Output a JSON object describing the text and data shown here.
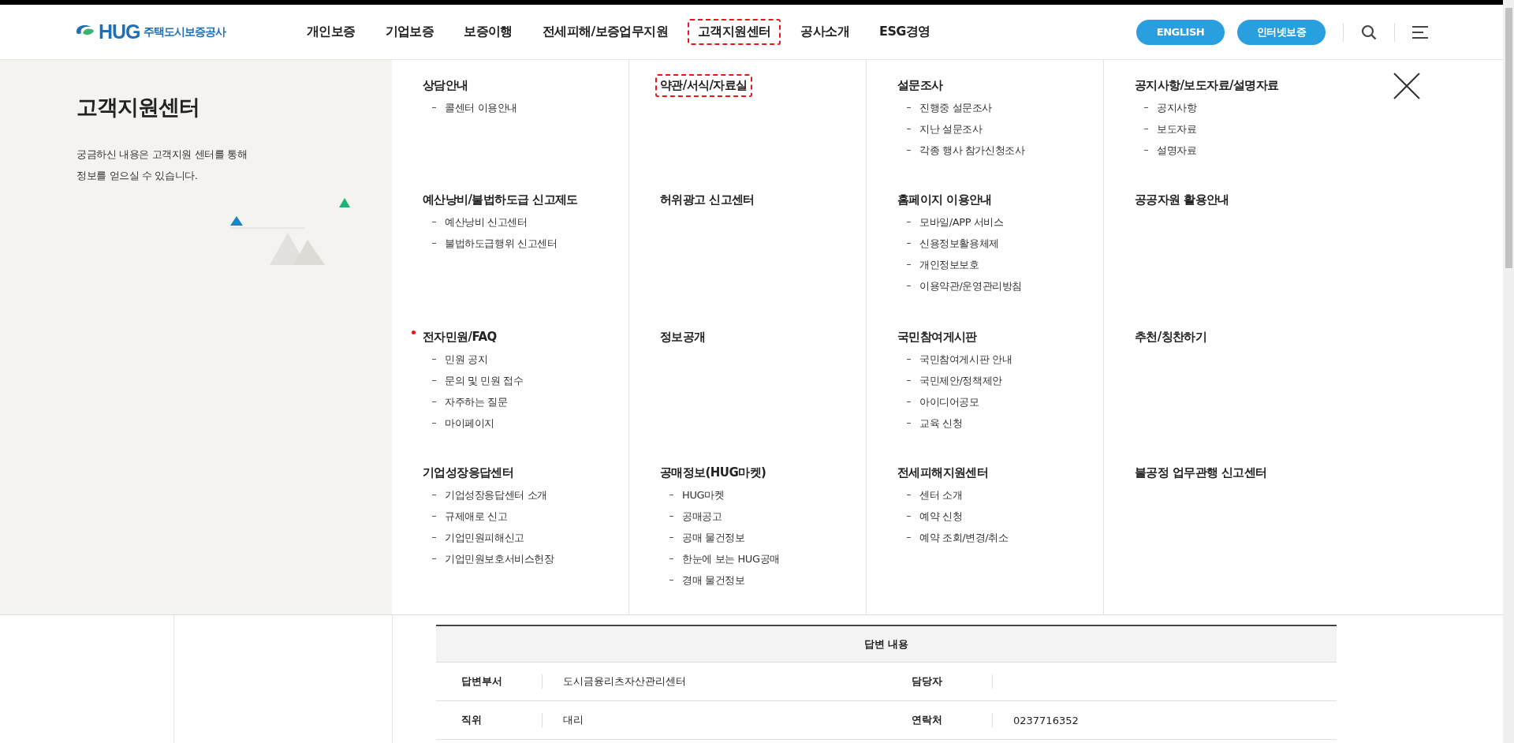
{
  "header": {
    "logo": {
      "brand": "HUG",
      "name": "주택도시보증공사"
    },
    "nav": [
      {
        "label": "개인보증",
        "highlighted": false
      },
      {
        "label": "기업보증",
        "highlighted": false
      },
      {
        "label": "보증이행",
        "highlighted": false
      },
      {
        "label": "전세피해/보증업무지원",
        "highlighted": false
      },
      {
        "label": "고객지원센터",
        "highlighted": true
      },
      {
        "label": "공사소개",
        "highlighted": false
      },
      {
        "label": "ESG경영",
        "highlighted": false
      }
    ],
    "buttons": [
      "ENGLISH",
      "인터넷보증"
    ]
  },
  "mega_menu": {
    "title": "고객지원센터",
    "description": "궁금하신 내용은 고객지원 센터를 통해\n정보를 얻으실 수 있습니다.",
    "sections": [
      {
        "title": "상담안내",
        "highlighted": false,
        "new": false,
        "items": [
          "콜센터 이용안내"
        ]
      },
      {
        "title": "약관/서식/자료실",
        "highlighted": true,
        "new": false
      },
      {
        "title": "설문조사",
        "highlighted": false,
        "new": false,
        "items": [
          "진행중 설문조사",
          "지난 설문조사",
          "각종 행사 참가신청조사"
        ]
      },
      {
        "title": "공지사항/보도자료/설명자료",
        "highlighted": false,
        "new": false,
        "items": [
          "공지사항",
          "보도자료",
          "설명자료"
        ]
      },
      {
        "title": "예산낭비/불법하도급 신고제도",
        "highlighted": false,
        "new": false,
        "items": [
          "예산낭비 신고센터",
          "불법하도급행위 신고센터"
        ]
      },
      {
        "title": "허위광고 신고센터",
        "highlighted": false,
        "new": false
      },
      {
        "title": "홈페이지 이용안내",
        "highlighted": false,
        "new": false,
        "items": [
          "모바일/APP 서비스",
          "신용정보활용체제",
          "개인정보보호",
          "이용약관/운영관리방침"
        ]
      },
      {
        "title": "공공자원 활용안내",
        "highlighted": false,
        "new": false
      },
      {
        "title": "전자민원/FAQ",
        "highlighted": false,
        "new": true,
        "items": [
          "민원 공지",
          "문의 및 민원 접수",
          "자주하는 질문",
          "마이페이지"
        ]
      },
      {
        "title": "정보공개",
        "highlighted": false,
        "new": false
      },
      {
        "title": "국민참여게시판",
        "highlighted": false,
        "new": false,
        "items": [
          "국민참여게시판 안내",
          "국민제안/정책제안",
          "아이디어공모",
          "교육 신청"
        ]
      },
      {
        "title": "추천/칭찬하기",
        "highlighted": false,
        "new": false
      },
      {
        "title": "기업성장응답센터",
        "highlighted": false,
        "new": false,
        "items": [
          "기업성장응답센터 소개",
          "규제애로 신고",
          "기업민원피해신고",
          "기업민원보호서비스헌장"
        ]
      },
      {
        "title": "공매정보(HUG마켓)",
        "highlighted": false,
        "new": false,
        "items": [
          "HUG마켓",
          "공매공고",
          "공매 물건정보",
          "한눈에 보는 HUG공매",
          "경매 물건정보"
        ]
      },
      {
        "title": "전세피해지원센터",
        "highlighted": false,
        "new": false,
        "items": [
          "센터 소개",
          "예약 신청",
          "예약 조회/변경/취소"
        ]
      },
      {
        "title": "불공정 업무관행 신고센터",
        "highlighted": false,
        "new": false
      }
    ]
  },
  "answer_table": {
    "title": "답변 내용",
    "rows": [
      [
        {
          "label": "답변부서",
          "value": "도시금융리츠자산관리센터"
        },
        {
          "label": "담당자"
        }
      ],
      [
        {
          "label": "직위",
          "value": "대리"
        },
        {
          "label": "연락처",
          "value": "0237716352"
        }
      ]
    ]
  }
}
